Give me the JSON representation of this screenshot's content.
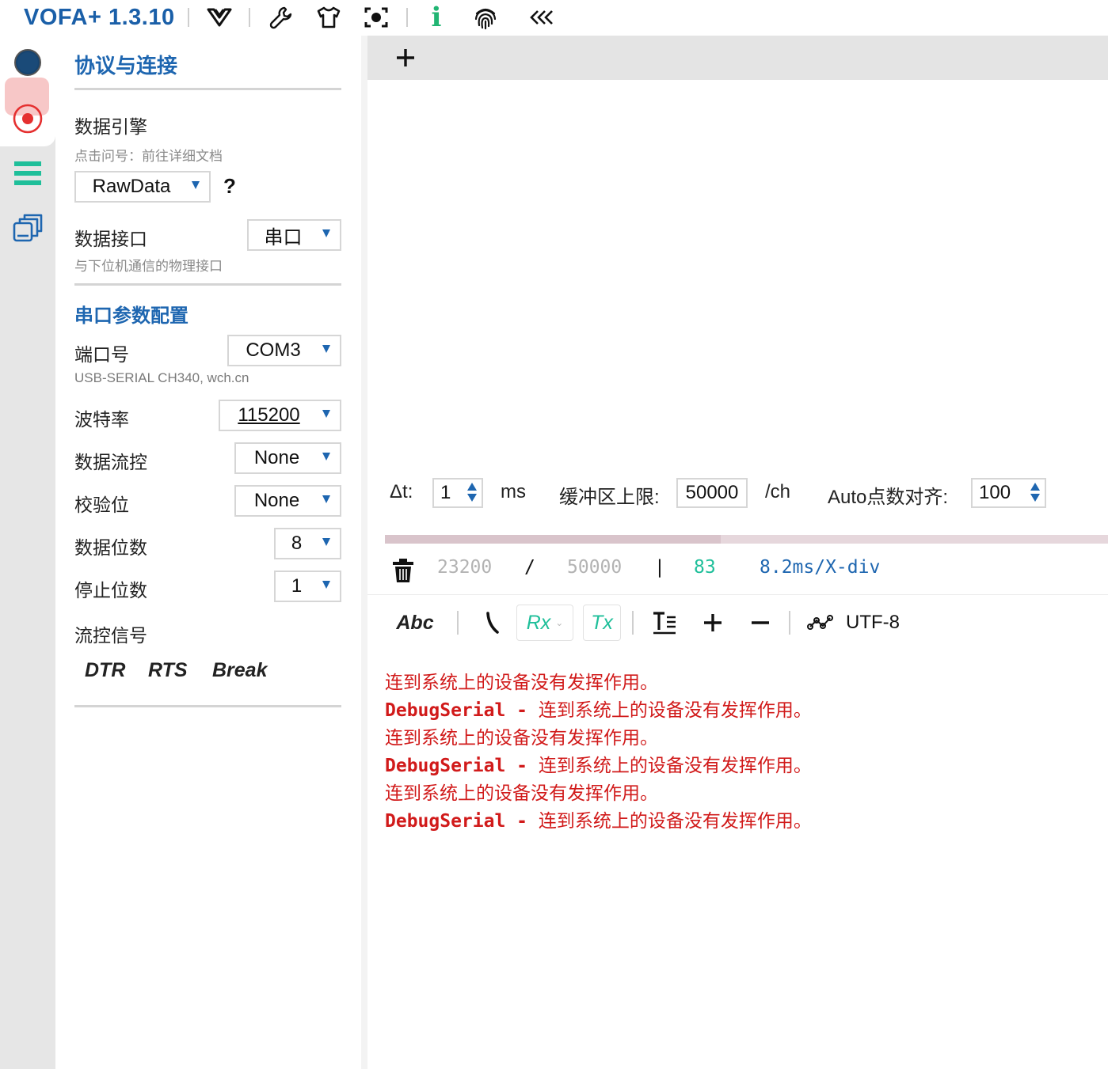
{
  "app": {
    "title": "VOFA+ 1.3.10"
  },
  "toolbar": {
    "icons": [
      "vofa-logo-icon",
      "wrench-icon",
      "shirt-icon",
      "capture-icon",
      "info-icon",
      "fingerprint-icon",
      "collapse-icon"
    ],
    "info_glyph": "i"
  },
  "rail": {
    "icons": [
      "connect-status-icon",
      "record-icon",
      "menu-icon",
      "windows-icon"
    ]
  },
  "panel": {
    "title": "协议与连接",
    "engine": {
      "label": "数据引擎",
      "hint": "点击问号：前往详细文档",
      "value": "RawData",
      "help": "?"
    },
    "interface": {
      "label": "数据接口",
      "hint": "与下位机通信的物理接口",
      "value": "串口"
    },
    "serial_title": "串口参数配置",
    "port": {
      "label": "端口号",
      "value": "COM3",
      "hint": "USB-SERIAL CH340, wch.cn"
    },
    "baud": {
      "label": "波特率",
      "value": "115200"
    },
    "flow": {
      "label": "数据流控",
      "value": "None"
    },
    "parity": {
      "label": "校验位",
      "value": "None"
    },
    "databits": {
      "label": "数据位数",
      "value": "8"
    },
    "stopbits": {
      "label": "停止位数",
      "value": "1"
    },
    "signals": {
      "label": "流控信号",
      "dtr": "DTR",
      "rts": "RTS",
      "brk": "Break"
    }
  },
  "controls": {
    "dt_label": "Δt:",
    "dt_value": "1",
    "dt_unit": "ms",
    "buffer_label": "缓冲区上限:",
    "buffer_value": "50000",
    "buffer_unit": "/ch",
    "auto_label": "Auto点数对齐:",
    "auto_value": "100"
  },
  "buffer_fill": 0.464,
  "stats": {
    "count": "23200",
    "slash": "/",
    "limit": "50000",
    "bar": "|",
    "channels": "83",
    "rate": "8.2ms/X-div"
  },
  "tools": {
    "abc": "Abc",
    "rx": "Rx",
    "tx": "Tx",
    "encoding": "UTF-8"
  },
  "log": [
    {
      "src": "",
      "sep": "",
      "msg": "连到系统上的设备没有发挥作用。"
    },
    {
      "src": "DebugSerial",
      "sep": " - ",
      "msg": "连到系统上的设备没有发挥作用。"
    },
    {
      "src": "",
      "sep": "",
      "msg": "连到系统上的设备没有发挥作用。"
    },
    {
      "src": "DebugSerial",
      "sep": " - ",
      "msg": "连到系统上的设备没有发挥作用。"
    },
    {
      "src": "",
      "sep": "",
      "msg": "连到系统上的设备没有发挥作用。"
    },
    {
      "src": "DebugSerial",
      "sep": " - ",
      "msg": "连到系统上的设备没有发挥作用。"
    }
  ],
  "colors": {
    "accent": "#1e66b0",
    "title": "#1a5fa8",
    "error": "#d11a1a",
    "teal": "#1fbf9a",
    "green": "#21b573",
    "muted": "#b3b3b3"
  }
}
